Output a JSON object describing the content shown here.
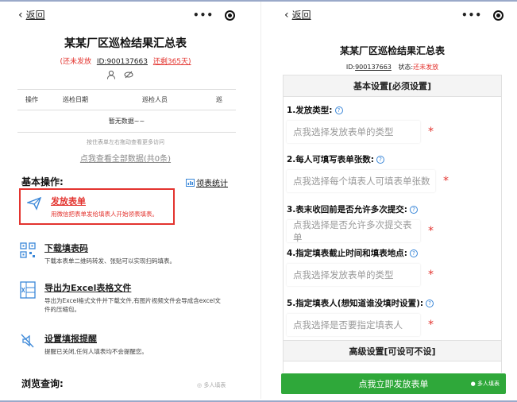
{
  "left": {
    "back_label": "返回",
    "title": "某某厂区巡检结果汇总表",
    "status": "(还未发放",
    "id_text": "ID:900137663",
    "remaining": "还剩365天)",
    "table_headers": [
      "操作",
      "巡检日期",
      "巡检人员",
      "巡"
    ],
    "empty_text": "暂无数据~~",
    "swipe_hint": "按住表单左右拖动查看更多访问",
    "view_all": "点我查看全部数据(共0条)",
    "section_basic": "基本操作:",
    "stats_link": "领表统计",
    "ops": [
      {
        "title": "发放表单",
        "desc": "用微信把表单发给填表人开始领表填表。",
        "icon": "send-icon"
      },
      {
        "title": "下载填表码",
        "desc": "下载本表单二维码转发、张贴可以实现扫码填表。",
        "icon": "qrcode-icon"
      },
      {
        "title": "导出为Excel表格文件",
        "desc": "导出为Excel格式文件并下载文件,有图片视频文件会导成含excel文件的压缩包。",
        "icon": "excel-icon"
      },
      {
        "title": "设置填报提醒",
        "desc": "提醒已关闭,任何人填表均不会提醒您。",
        "icon": "mute-icon"
      }
    ],
    "section_browse": "浏览查询:",
    "brand": "多人填表"
  },
  "right": {
    "back_label": "返回",
    "title": "某某厂区巡检结果汇总表",
    "id_label": "ID:",
    "id_value": "900137663",
    "status_label": "状态:",
    "status_value": "还未发放",
    "basic_header": "基本设置[必须设置]",
    "fields": [
      {
        "label": "1.发放类型:",
        "placeholder": "点我选择发放表单的类型"
      },
      {
        "label": "2.每人可填写表单张数:",
        "placeholder": "点我选择每个填表人可填表单张数"
      },
      {
        "label": "3.表末收回前是否允许多次提交:",
        "placeholder": "点我选择是否允许多次提交表单"
      },
      {
        "label": "4.指定填表截止时间和填表地点:",
        "placeholder": "点我选择发放表单的类型"
      },
      {
        "label": "5.指定填表人(想知道谁没填时设置):",
        "placeholder": "点我选择是否要指定填表人"
      }
    ],
    "advanced_header": "高级设置[可设可不设]",
    "submit_label": "点我立即发放表单",
    "brand": "多人填表"
  },
  "colors": {
    "accent_red": "#e3342f",
    "primary_green": "#2fa83a",
    "link_blue": "#3a87d8"
  }
}
